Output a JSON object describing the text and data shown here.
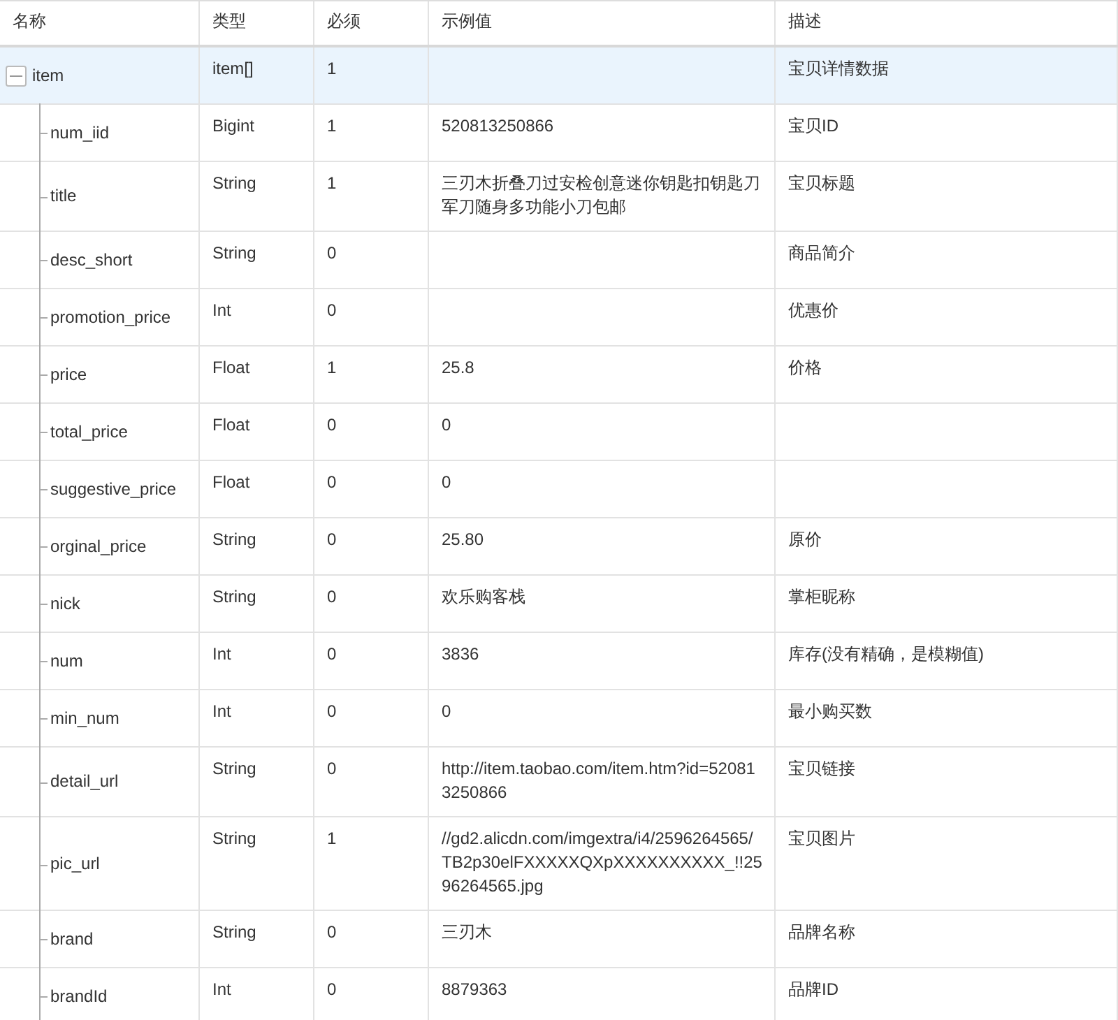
{
  "table": {
    "columns": [
      "名称",
      "类型",
      "必须",
      "示例值",
      "描述"
    ],
    "rows": [
      {
        "name": "item",
        "type": "item[]",
        "required": "1",
        "description": "宝贝详情数据",
        "selected": true,
        "expanded": true,
        "children": [
          {
            "name": "num_iid",
            "type": "Bigint",
            "required": "1",
            "example": "520813250866",
            "description": "宝贝ID",
            "selected": false
          },
          {
            "name": "title",
            "type": "String",
            "required": "1",
            "example": "三刃木折叠刀过安检创意迷你钥匙扣钥匙刀军刀随身多功能小刀包邮",
            "description": "宝贝标题",
            "selected": false
          },
          {
            "name": "desc_short",
            "type": "String",
            "required": "0",
            "description": "商品简介",
            "selected": false
          },
          {
            "name": "promotion_price",
            "type": "Int",
            "required": "0",
            "description": "优惠价",
            "selected": false
          },
          {
            "name": "price",
            "type": "Float",
            "required": "1",
            "example": "25.8",
            "description": "价格",
            "selected": false
          },
          {
            "name": "total_price",
            "type": "Float",
            "required": "0",
            "example": "0",
            "selected": false
          },
          {
            "name": "suggestive_price",
            "type": "Float",
            "required": "0",
            "example": "0",
            "selected": false
          },
          {
            "name": "orginal_price",
            "type": "String",
            "required": "0",
            "example": "25.80",
            "description": "原价",
            "selected": false
          },
          {
            "name": "nick",
            "type": "String",
            "required": "0",
            "example": "欢乐购客栈",
            "description": "掌柜昵称",
            "selected": false
          },
          {
            "name": "num",
            "type": "Int",
            "required": "0",
            "example": "3836",
            "description": "库存(没有精确，是模糊值)",
            "selected": false
          },
          {
            "name": "min_num",
            "type": "Int",
            "required": "0",
            "example": "0",
            "description": "最小购买数",
            "selected": false
          },
          {
            "name": "detail_url",
            "type": "String",
            "required": "0",
            "example": "http://item.taobao.com/item.htm?id=520813250866",
            "description": "宝贝链接",
            "selected": false
          },
          {
            "name": "pic_url",
            "type": "String",
            "required": "1",
            "example": "//gd2.alicdn.com/imgextra/i4/2596264565/TB2p30elFXXXXXQXpXXXXXXXXXX_!!2596264565.jpg",
            "description": "宝贝图片",
            "selected": false
          },
          {
            "name": "brand",
            "type": "String",
            "required": "0",
            "example": "三刃木",
            "description": "品牌名称",
            "selected": false
          },
          {
            "name": "brandId",
            "type": "Int",
            "required": "0",
            "example": "8879363",
            "description": "品牌ID",
            "selected": false
          }
        ]
      }
    ]
  }
}
